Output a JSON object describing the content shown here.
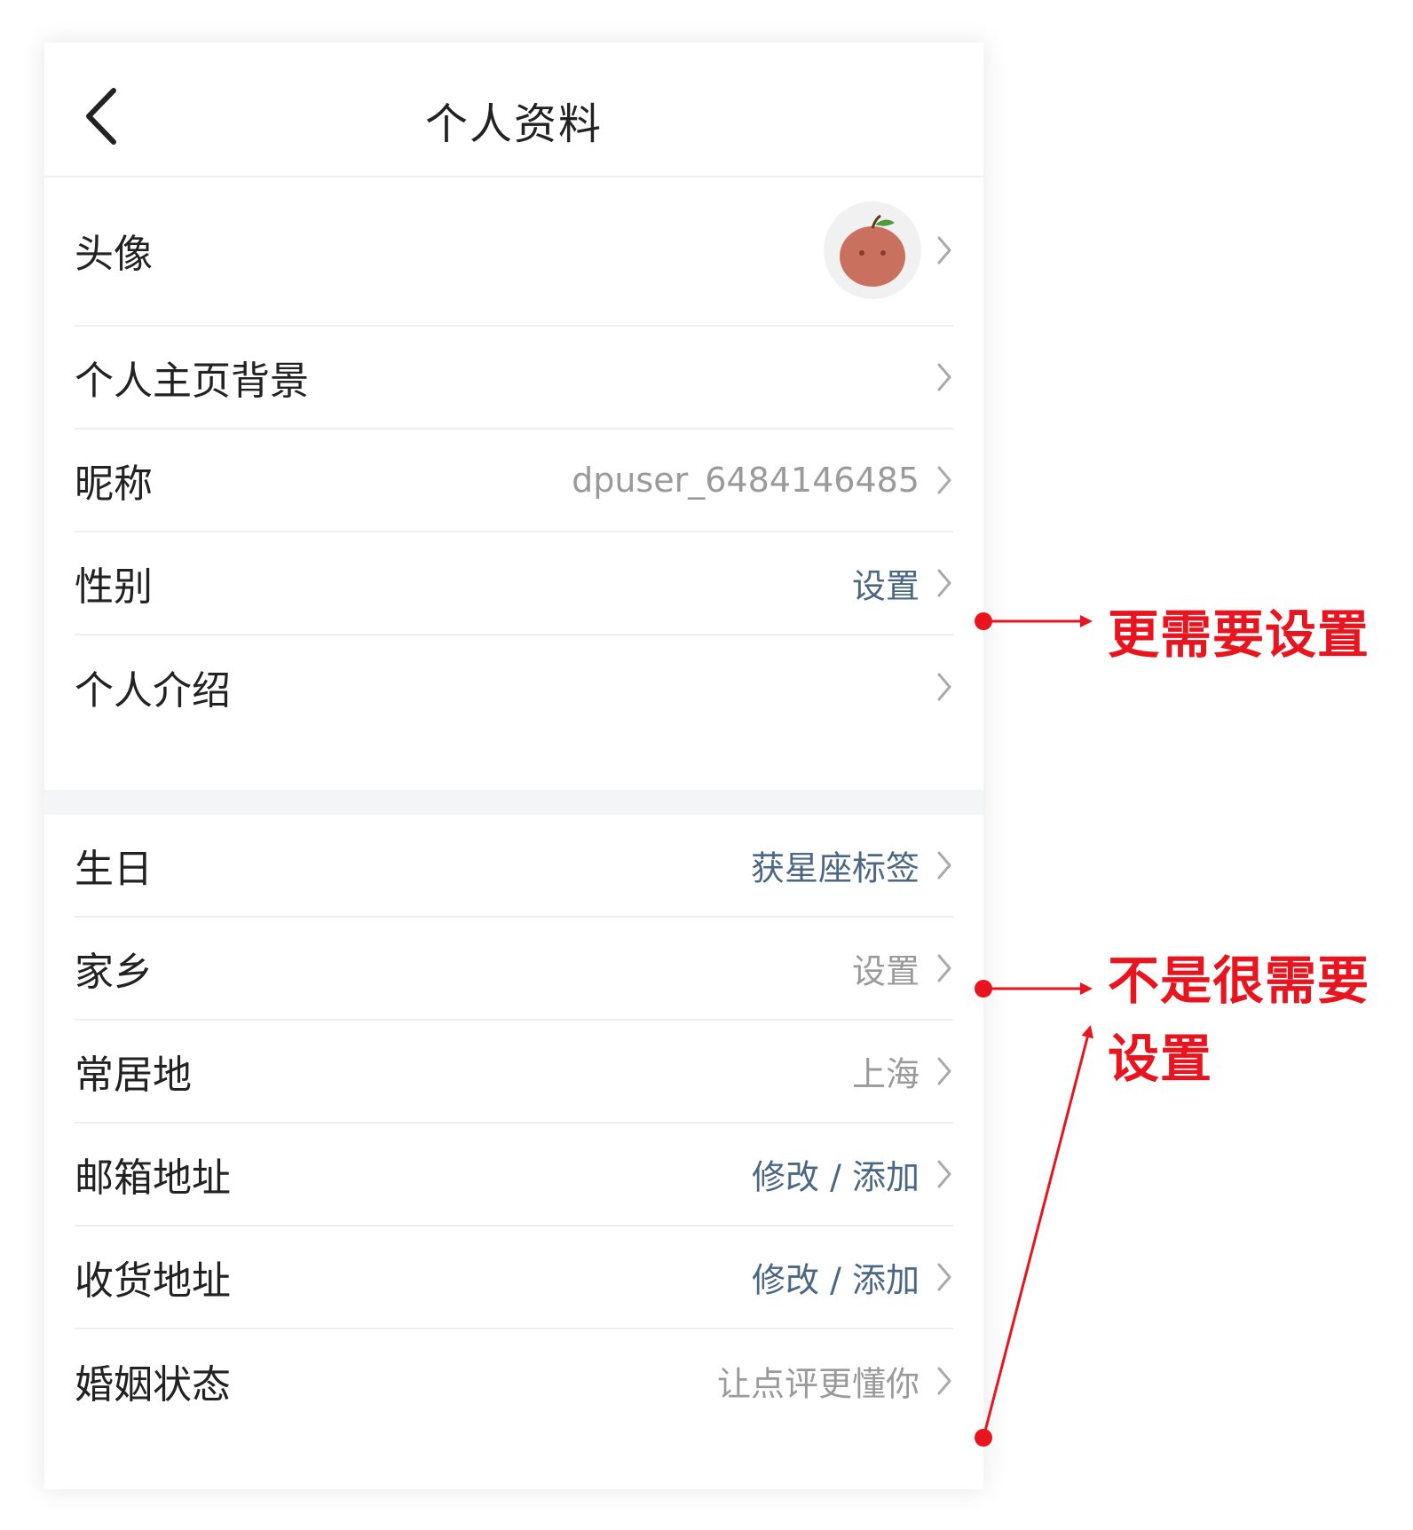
{
  "header": {
    "title": "个人资料"
  },
  "section1": [
    {
      "label": "头像",
      "value": "",
      "type": "avatar"
    },
    {
      "label": "个人主页背景",
      "value": "",
      "type": "plain"
    },
    {
      "label": "昵称",
      "value": "dpuser_6484146485",
      "type": "gray"
    },
    {
      "label": "性别",
      "value": "设置",
      "type": "blue"
    },
    {
      "label": "个人介绍",
      "value": "",
      "type": "plain"
    }
  ],
  "section2": [
    {
      "label": "生日",
      "value": "获星座标签",
      "type": "blue"
    },
    {
      "label": "家乡",
      "value": "设置",
      "type": "gray"
    },
    {
      "label": "常居地",
      "value": "上海",
      "type": "gray"
    },
    {
      "label": "邮箱地址",
      "value": "修改 / 添加",
      "type": "blue"
    },
    {
      "label": "收货地址",
      "value": "修改 / 添加",
      "type": "blue"
    },
    {
      "label": "婚姻状态",
      "value": "让点评更懂你",
      "type": "gray"
    }
  ],
  "annotations": {
    "more_needed": "更需要设置",
    "less_needed_line1": "不是很需要",
    "less_needed_line2": "设置"
  },
  "colors": {
    "annotation": "#e8141e",
    "value_blue": "#4a6784",
    "value_gray": "#9a9a9a"
  },
  "icons": {
    "back": "chevron-left-icon",
    "row_arrow": "chevron-right-icon",
    "avatar": "apple-avatar-icon"
  }
}
